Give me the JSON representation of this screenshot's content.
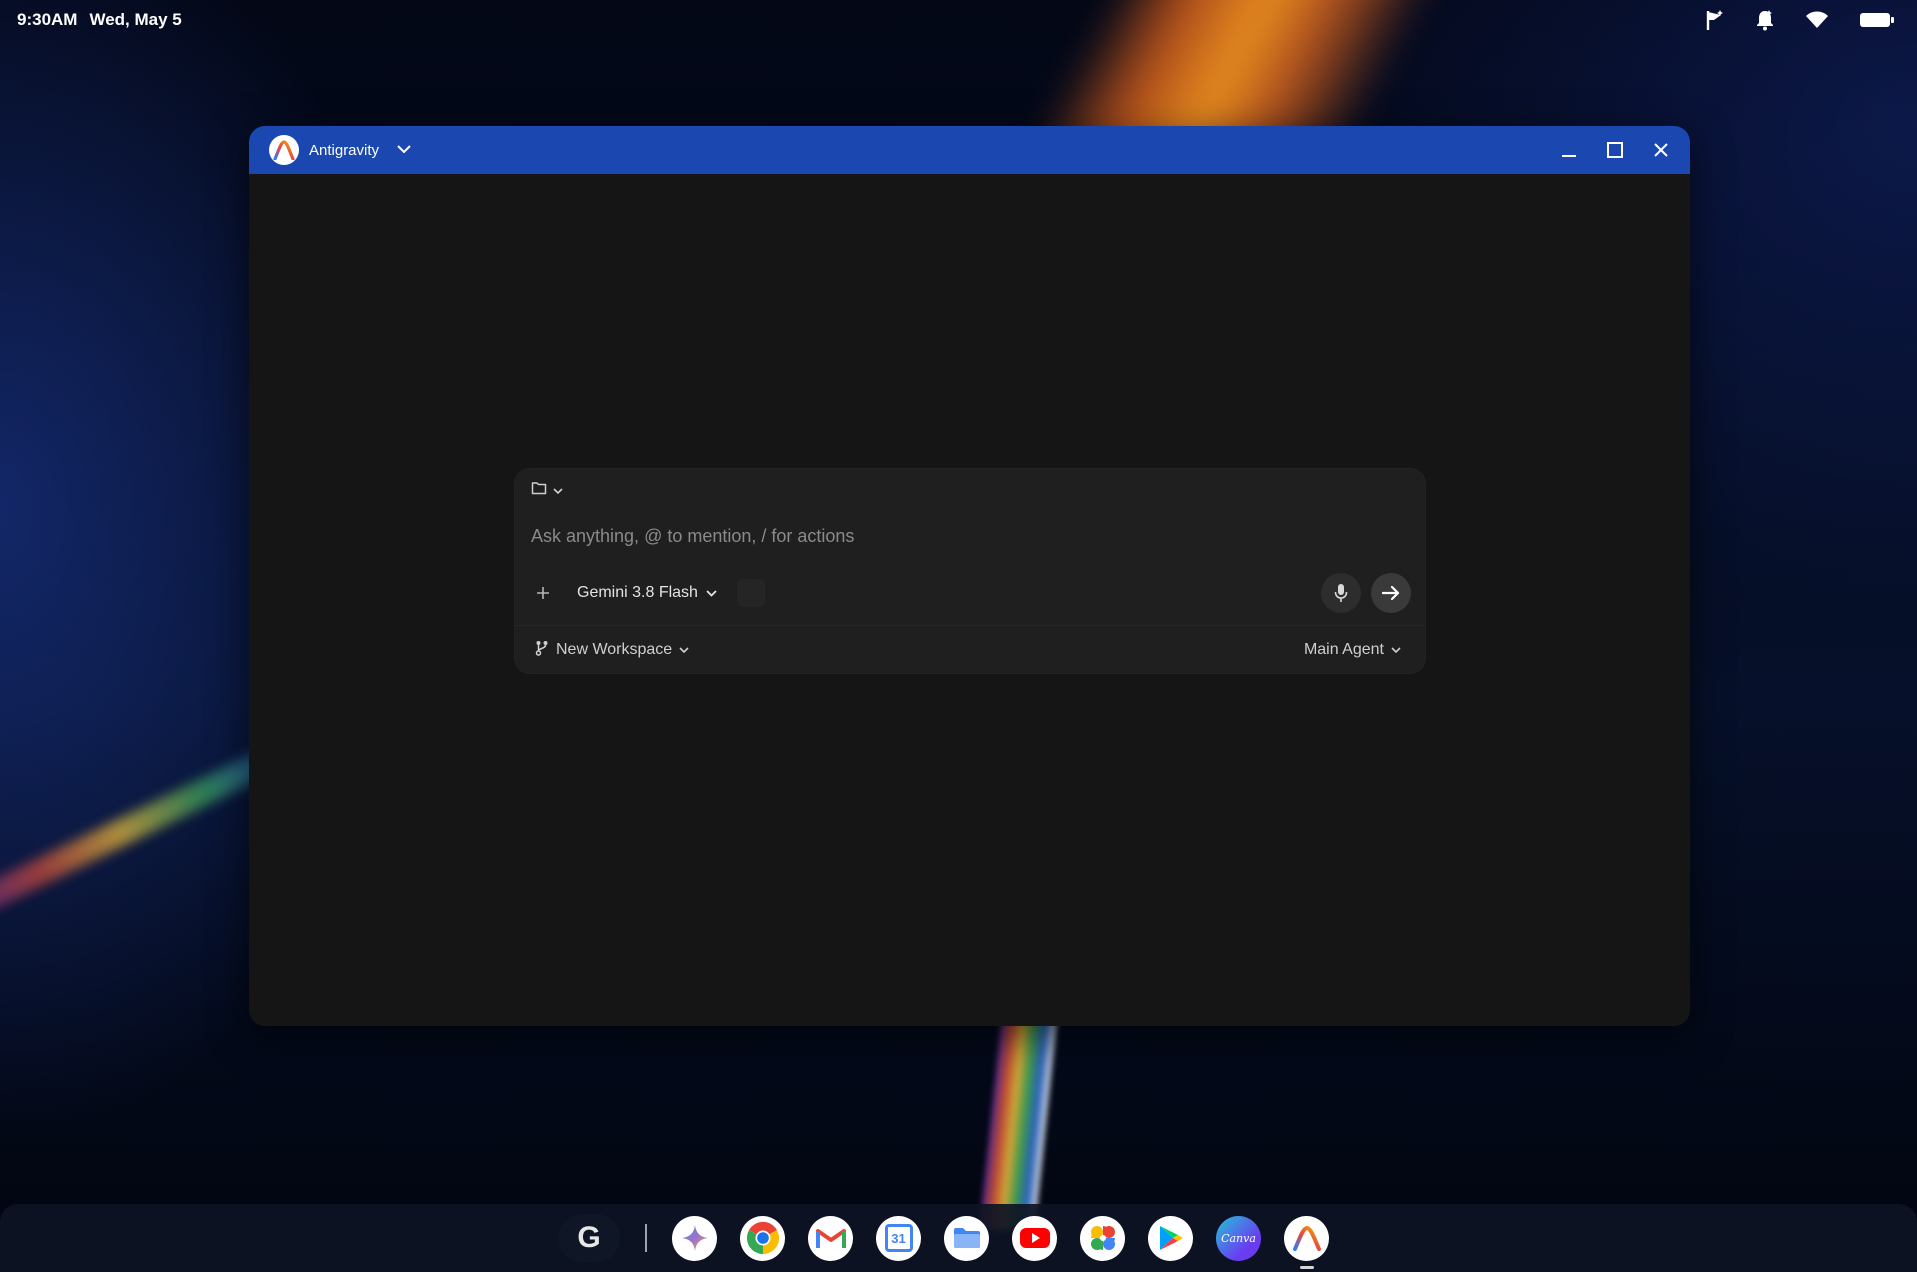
{
  "status_bar": {
    "time": "9:30AM",
    "date": "Wed, May 5",
    "icons": [
      "flag-icon",
      "notifications-off-icon",
      "wifi-icon",
      "battery-icon"
    ]
  },
  "window": {
    "app_title": "Antigravity",
    "controls": [
      "minimize-icon",
      "maximize-icon",
      "close-icon"
    ],
    "accent_color": "#1a47b0"
  },
  "composer": {
    "prompt_placeholder": "Ask anything, @ to mention, / for actions",
    "model_label": "Gemini 3.8 Flash",
    "workspace_label": "New Workspace",
    "agent_label": "Main Agent"
  },
  "shelf": {
    "launcher_letter": "G",
    "calendar_day": "31",
    "canva_label": "Canva",
    "apps": [
      "gemini",
      "chrome",
      "gmail",
      "calendar",
      "files",
      "youtube",
      "photos",
      "play-store",
      "canva",
      "antigravity"
    ]
  }
}
